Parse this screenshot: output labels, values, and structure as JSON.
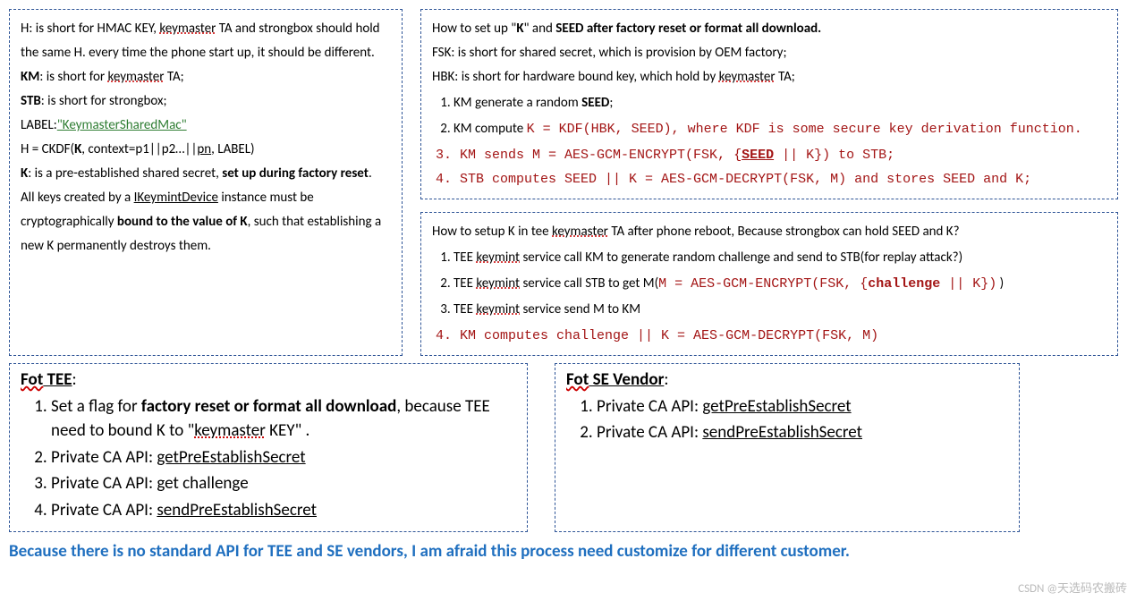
{
  "defs": {
    "h_pre": "H: is short for HMAC KEY,  ",
    "h_keymaster": "keymaster",
    "h_post": " TA and strongbox should hold the same H. every time the phone start up, it should be different.",
    "km_label": "KM",
    "km_text": ": is short for ",
    "km_term": "keymaster",
    "km_end": " TA;",
    "stb_label": "STB",
    "stb_text": ": is short for strongbox;",
    "label_label": "LABEL:",
    "label_value": "\"KeymasterSharedMac\"",
    "h_formula_pre": "H = CKDF(",
    "h_formula_k": "K",
    "h_formula_mid": ", context=p1||p2…||",
    "h_formula_pn": "pn",
    "h_formula_end": ", LABEL)",
    "k_label": "K",
    "k_text": ": is a pre-established shared secret, ",
    "k_bold": "set up during factory reset",
    "k_end": ".",
    "keys_pre": "All keys created by a ",
    "keys_term": "IKeymintDevice",
    "keys_mid": " instance must be cryptographically ",
    "keys_bold": "bound to the value of  K",
    "keys_end": ", such that establishing a new K permanently destroys them."
  },
  "setup1": {
    "title_pre": "How to set up \"",
    "title_k": "K",
    "title_mid": "\" and ",
    "title_bold": "SEED after factory reset or format all download.",
    "fsk": "FSK: is short for shared secret, which is provision by OEM factory;",
    "hbk_pre": "HBK: is short for hardware bound key, which hold by ",
    "hbk_term": "keymaster",
    "hbk_end": " TA;",
    "s1_pre": "KM generate a random ",
    "s1_bold": "SEED",
    "s1_end": ";",
    "s2_pre": "KM compute ",
    "s2_code": "K = KDF(HBK, SEED), where KDF is some secure key derivation function.",
    "s3": "KM sends M = AES-GCM-ENCRYPT(FSK, {",
    "s3_bold": "SEED",
    "s3_end": " || K}) to STB;",
    "s4": "STB computes SEED || K = AES-GCM-DECRYPT(FSK, M) and stores SEED and K;"
  },
  "setup2": {
    "title_pre": "How to setup K in tee ",
    "title_term": "keymaster",
    "title_end": " TA after phone reboot, Because strongbox can hold SEED and K?",
    "s1_pre": "TEE ",
    "s1_term": "keymint",
    "s1_end": " service call KM to generate random challenge and send to STB(for replay attack?)",
    "s2_pre": "TEE ",
    "s2_term": "keymint",
    "s2_mid": " service call STB to get M(",
    "s2_code_pre": "M = AES-GCM-ENCRYPT(FSK, {",
    "s2_bold": "challenge",
    "s2_code_end": " || K})",
    "s2_end": " )",
    "s3_pre": "TEE ",
    "s3_term": "keymint",
    "s3_end": " service send M to KM",
    "s4": "KM computes challenge || K = AES-GCM-DECRYPT(FSK, M)"
  },
  "tee": {
    "title_pre": "Fot",
    "title_post": " TEE",
    "colon": ":",
    "s1_pre": "Set a flag for ",
    "s1_bold": "factory reset or format all download",
    "s1_mid": ", because TEE need to bound K to \"",
    "s1_term": "keymaster",
    "s1_end": " KEY\" .",
    "s2_pre": "Private CA API: ",
    "s2_api": "getPreEstablishSecret",
    "s3": "Private CA API: get challenge",
    "s4_pre": "Private CA API: ",
    "s4_api": "sendPreEstablishSecret"
  },
  "se": {
    "title_pre": "Fot",
    "title_post": " SE Vendor",
    "colon": ":",
    "s1_pre": "Private CA API: ",
    "s1_api": "getPreEstablishSecret",
    "s2_pre": "Private CA API: ",
    "s2_api": "sendPreEstablishSecret"
  },
  "footer": "Because there is no standard API for TEE and SE vendors, I am afraid this process need customize for different customer.",
  "watermark": "CSDN @天选码农搬砖"
}
